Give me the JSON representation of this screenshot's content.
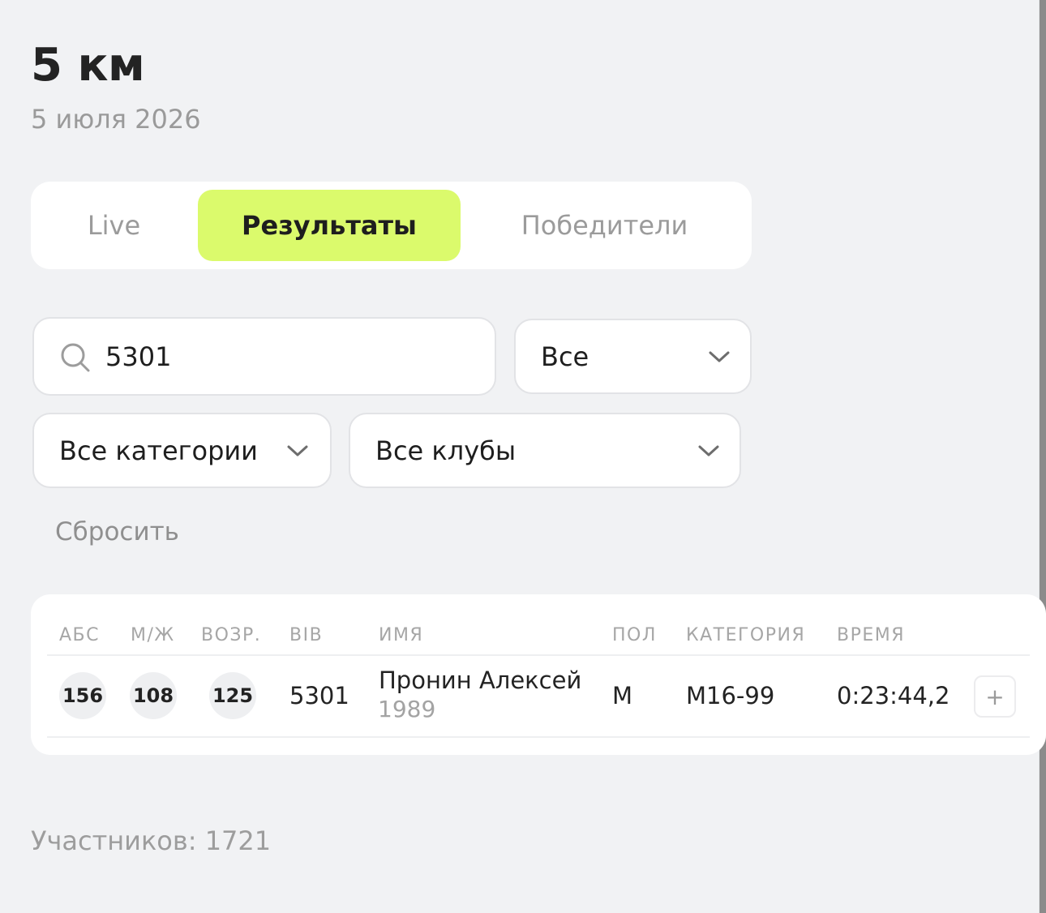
{
  "race": {
    "title": "5 км",
    "date": "5 июля 2026"
  },
  "tabs": [
    {
      "label": "Live"
    },
    {
      "label": "Результаты",
      "active": true
    },
    {
      "label": "Победители"
    }
  ],
  "filters": {
    "search_value": "5301",
    "gender": "Все",
    "category": "Все категории",
    "club": "Все клубы",
    "reset_label": "Сбросить"
  },
  "table": {
    "headers": [
      "АБС",
      "М/Ж",
      "ВОЗР.",
      "BIB",
      "ИМЯ",
      "ПОЛ",
      "КАТЕГОРИЯ",
      "ВРЕМЯ"
    ],
    "rows": [
      {
        "abs": "156",
        "gender_place": "108",
        "age_place": "125",
        "bib": "5301",
        "name": "Пронин Алексей",
        "year": "1989",
        "sex": "М",
        "category": "М16-99",
        "time": "0:23:44,2",
        "expand": "+"
      }
    ]
  },
  "footer": {
    "participants": "Участников: 1721"
  },
  "colors": {
    "accent": "#dbfa6c",
    "background": "#f1f2f4",
    "card": "#ffffff"
  }
}
